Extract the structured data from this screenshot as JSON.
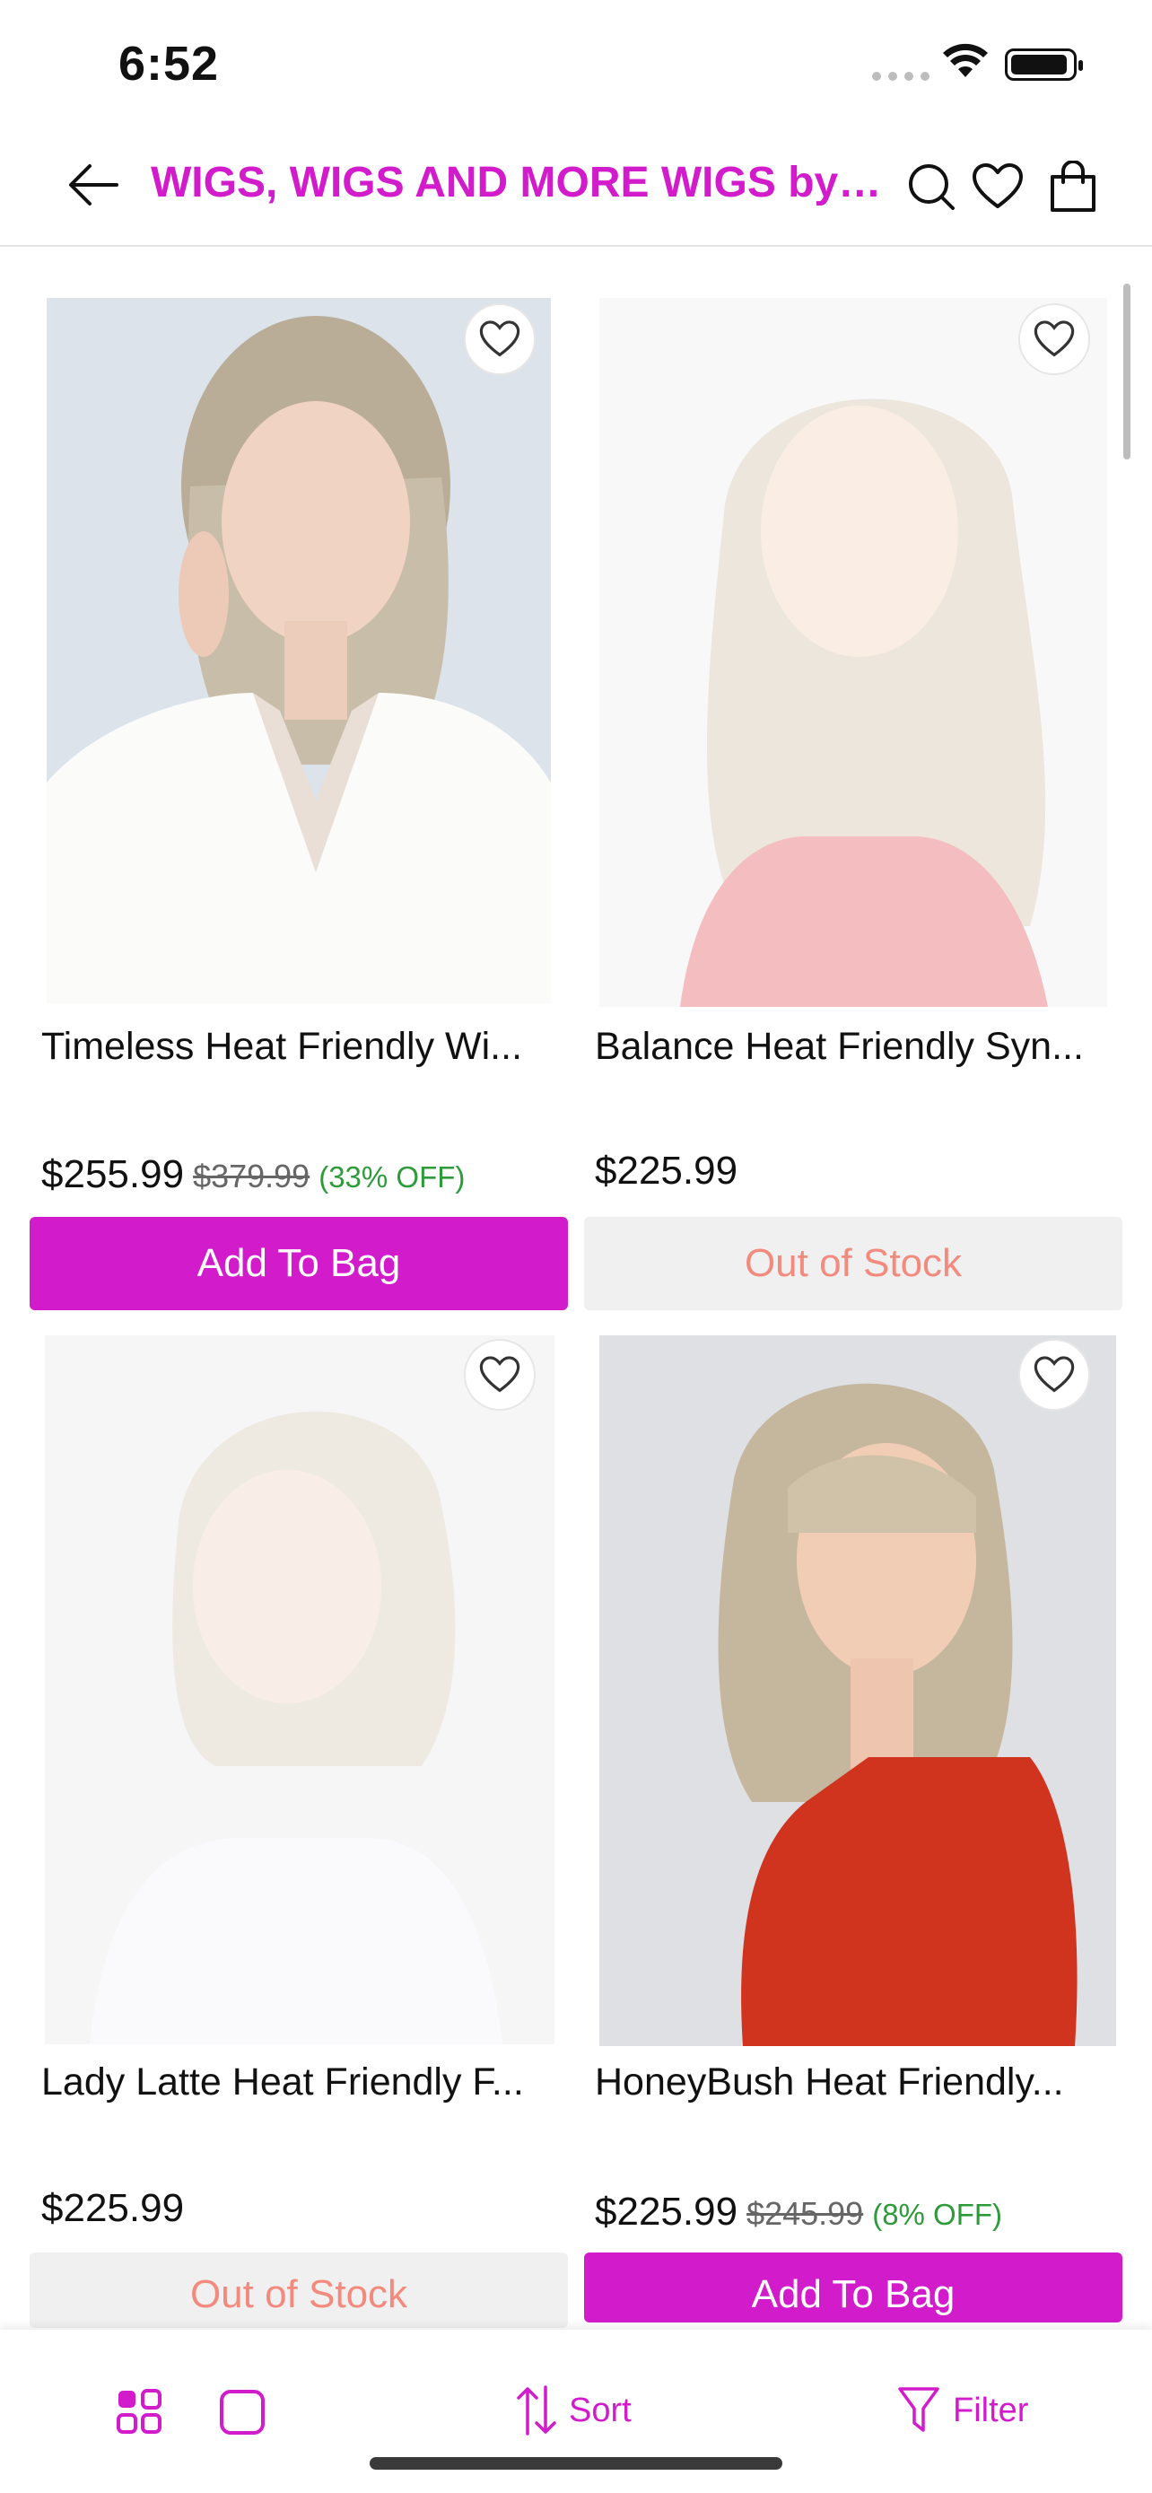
{
  "status_bar": {
    "time": "6:52"
  },
  "header": {
    "title": "WIGS, WIGS AND MORE WIGS by B...",
    "accent_color": "#d21ccc",
    "icons": [
      "back-arrow-icon",
      "search-icon",
      "heart-icon",
      "shopping-bag-icon"
    ]
  },
  "products": [
    {
      "name": "Timeless Heat Friendly Wi...",
      "price": "$255.99",
      "was": "$379.99",
      "off": "(33% OFF)",
      "button": "Add To Bag",
      "in_stock": true
    },
    {
      "name": "Balance Heat Friendly Syn...",
      "price": "$225.99",
      "was": "",
      "off": "",
      "button": "Out of Stock",
      "in_stock": false
    },
    {
      "name": "Lady Latte Heat Friendly F...",
      "price": "$225.99",
      "was": "",
      "off": "",
      "button": "Out of Stock",
      "in_stock": false
    },
    {
      "name": "HoneyBush Heat Friendly...",
      "price": "$225.99",
      "was": "$245.99",
      "off": "(8% OFF)",
      "button": "Add To Bag",
      "in_stock": true
    }
  ],
  "toolbar": {
    "sort_label": "Sort",
    "filter_label": "Filter",
    "icons": [
      "grid-view-icon",
      "single-view-icon",
      "sort-icon",
      "filter-icon"
    ]
  },
  "colors": {
    "accent": "#d21ccc",
    "discount": "#2e9b3b",
    "out_of_stock_text": "#f28a7e"
  }
}
